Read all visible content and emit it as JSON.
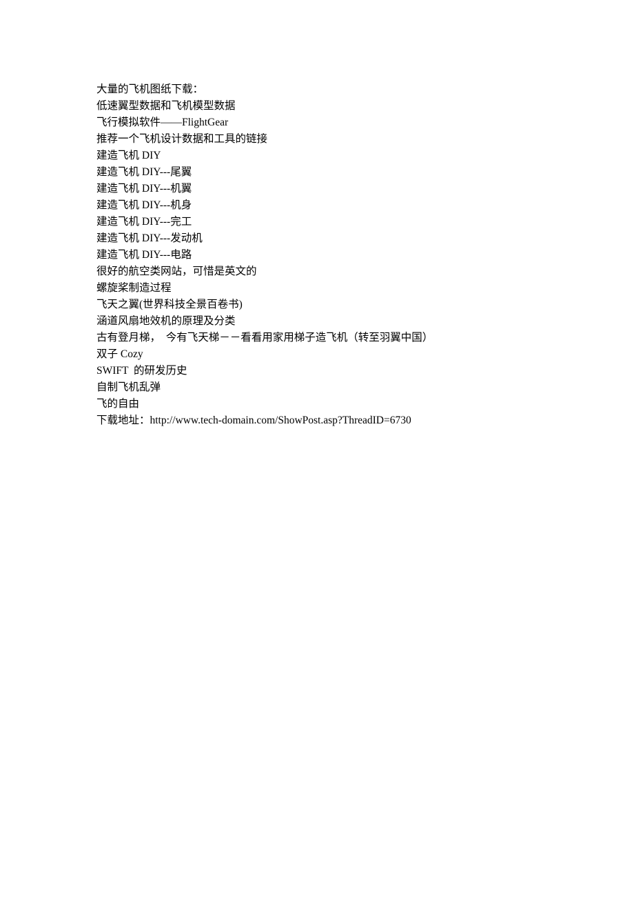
{
  "lines": [
    "大量的飞机图纸下载：",
    "低速翼型数据和飞机模型数据",
    "飞行模拟软件——FlightGear",
    "推荐一个飞机设计数据和工具的链接",
    "建造飞机 DIY",
    "建造飞机 DIY---尾翼",
    "建造飞机 DIY---机翼",
    "建造飞机 DIY---机身",
    "建造飞机 DIY---完工",
    "建造飞机 DIY---发动机",
    "建造飞机 DIY---电路",
    "很好的航空类网站，可惜是英文的",
    "螺旋桨制造过程",
    "飞天之翼(世界科技全景百卷书)",
    "涵道风扇地效机的原理及分类",
    "古有登月梯，  今有飞天梯－－看看用家用梯子造飞机（转至羽翼中国）",
    "双子 Cozy",
    "SWIFT  的研发历史",
    "自制飞机乱弹",
    "飞的自由",
    "下载地址：http://www.tech-domain.com/ShowPost.asp?ThreadID=6730"
  ]
}
